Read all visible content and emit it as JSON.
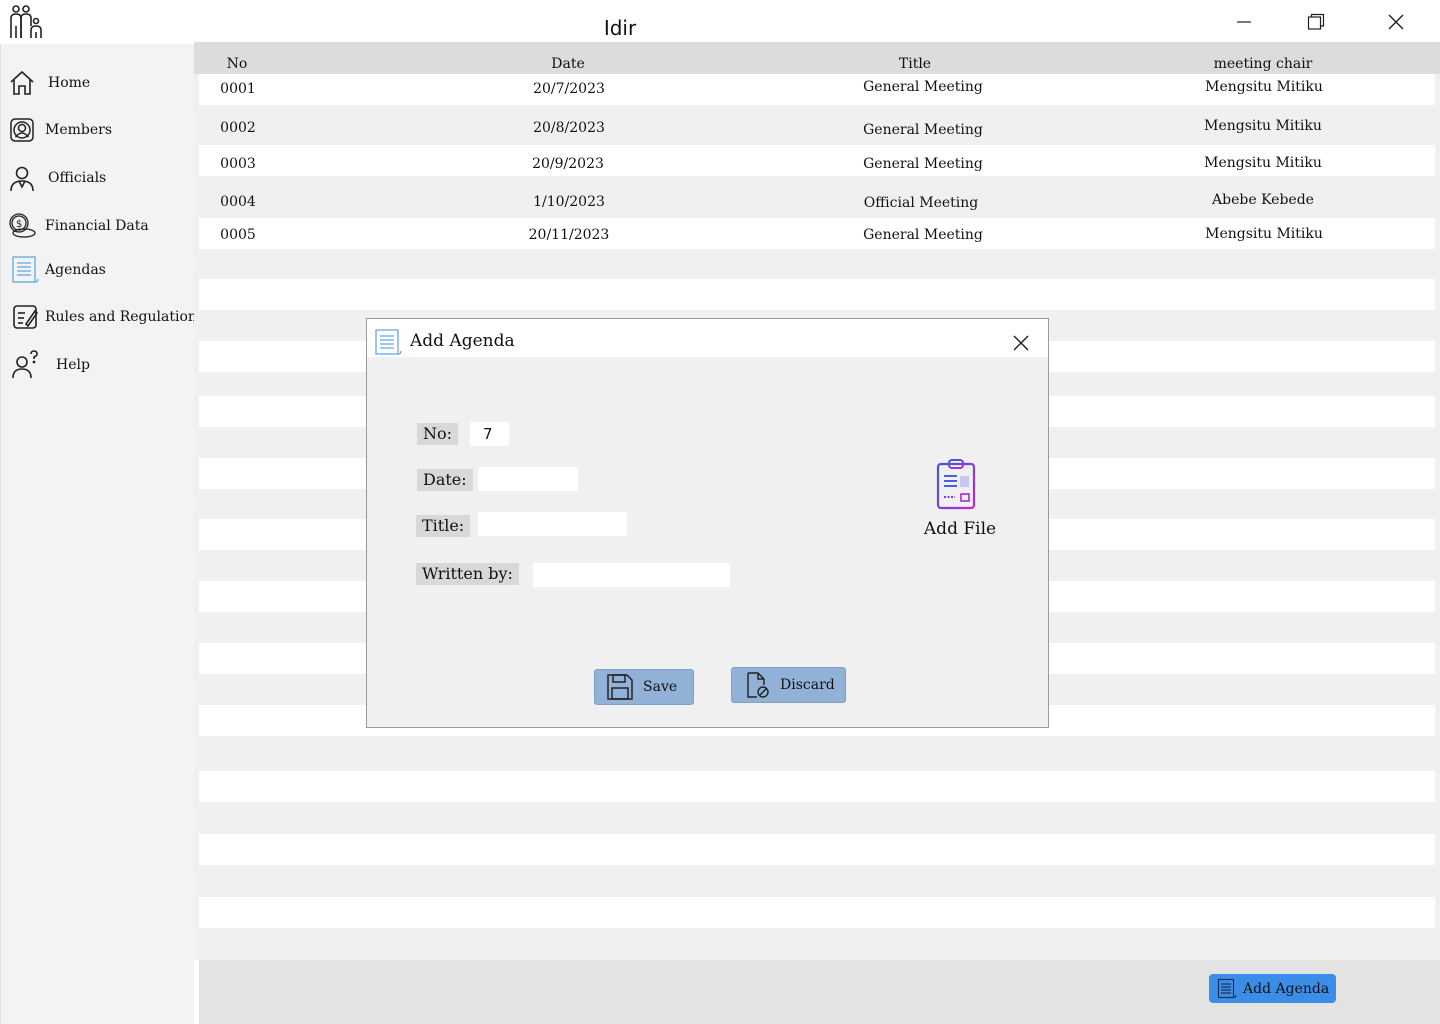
{
  "window": {
    "title": "Idir",
    "controls": [
      "minimize",
      "maximize",
      "close"
    ]
  },
  "sidebar": {
    "items": [
      {
        "label": "Home",
        "icon": "home-icon"
      },
      {
        "label": "Members",
        "icon": "members-icon"
      },
      {
        "label": "Officials",
        "icon": "official-icon"
      },
      {
        "label": "Financial Data",
        "icon": "coins-icon"
      },
      {
        "label": "Agendas",
        "icon": "agenda-icon"
      },
      {
        "label": "Rules and Regulations",
        "icon": "rules-icon"
      },
      {
        "label": "Help",
        "icon": "help-icon"
      }
    ]
  },
  "table": {
    "headers": [
      "No",
      "Date",
      "Title",
      "meeting chair"
    ],
    "rows": [
      {
        "no": "0001",
        "date": "20/7/2023",
        "title": "General Meeting",
        "chair": "Mengsitu Mitiku"
      },
      {
        "no": "0002",
        "date": "20/8/2023",
        "title": "General Meeting",
        "chair": "Mengsitu Mitiku"
      },
      {
        "no": "0003",
        "date": "20/9/2023",
        "title": "General Meeting",
        "chair": "Mengsitu Mitiku"
      },
      {
        "no": "0004",
        "date": "1/10/2023",
        "title": "Official Meeting",
        "chair": "Abebe Kebede"
      },
      {
        "no": "0005",
        "date": "20/11/2023",
        "title": "General Meeting",
        "chair": "Mengsitu Mitiku"
      }
    ]
  },
  "footer": {
    "add_agenda_label": "Add Agenda"
  },
  "dialog": {
    "title": "Add Agenda",
    "fields": {
      "no": {
        "label": "No:",
        "value": "7"
      },
      "date": {
        "label": "Date:",
        "value": ""
      },
      "title": {
        "label": "Title:",
        "value": ""
      },
      "written_by": {
        "label": "Written by:",
        "value": ""
      }
    },
    "add_file_label": "Add File",
    "save_label": "Save",
    "discard_label": "Discard"
  },
  "colors": {
    "accent_button": "#3b8de8",
    "dialog_button": "#91b2d6",
    "add_file_icon": "#7a3fe0"
  }
}
